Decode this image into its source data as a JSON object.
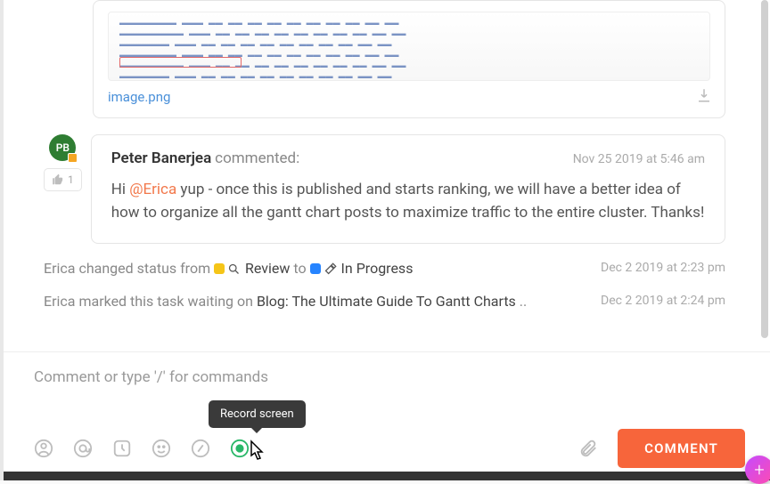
{
  "attachment": {
    "filename": "image.png"
  },
  "comment": {
    "initials": "PB",
    "author": "Peter Banerjea",
    "verb": " commented:",
    "timestamp": "Nov 25 2019 at 5:46 am",
    "text_pre": "Hi ",
    "mention": "@Erica",
    "text_post": " yup - once this is published and starts ranking, we will have a better idea of how to organize all the gantt chart posts to maximize traffic to the entire cluster. Thanks!",
    "likes": "1"
  },
  "activity1": {
    "actor": "Erica",
    "pre": " changed status from ",
    "from": " Review",
    "mid": " to ",
    "to": " In Progress",
    "ts": "Dec 2 2019 at 2:23 pm"
  },
  "activity2": {
    "actor": "Erica",
    "pre": " marked this task waiting on ",
    "target": "Blog: The Ultimate Guide To Gantt Charts",
    "dots": " ..",
    "ts": "Dec 2 2019 at 2:24 pm"
  },
  "composer": {
    "placeholder": "Comment or type '/' for commands",
    "tooltip": "Record screen",
    "button": "COMMENT"
  }
}
